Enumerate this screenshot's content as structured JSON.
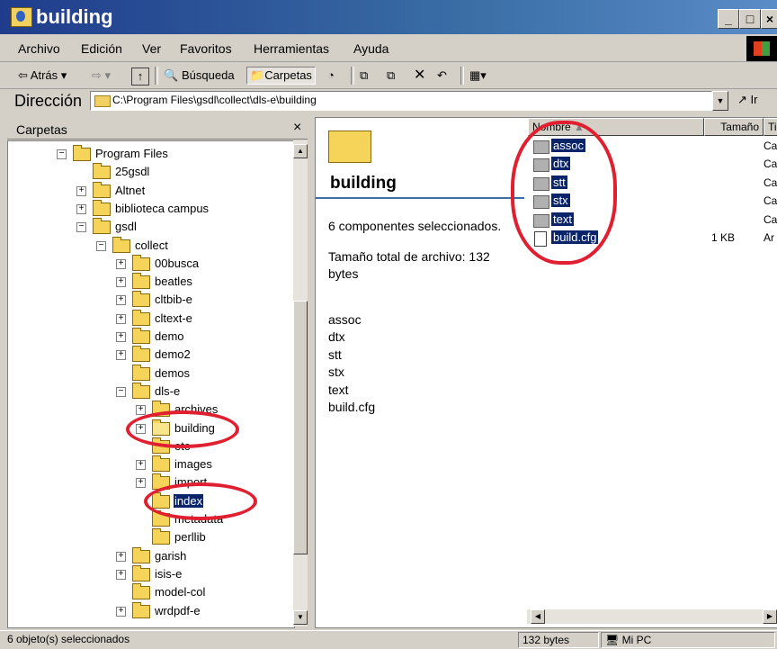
{
  "window": {
    "title": "building"
  },
  "menu": [
    "Archivo",
    "Edición",
    "Ver",
    "Favoritos",
    "Herramientas",
    "Ayuda"
  ],
  "toolbar": {
    "back": "⇦ Atrás ▾",
    "forward": "⇨ ▾",
    "search": "Búsqueda",
    "folders": "Carpetas"
  },
  "address": {
    "label": "Dirección",
    "value": "C:\\Program Files\\gsdl\\collect\\dls-e\\building",
    "go": "Ir"
  },
  "folders_pane": {
    "title": "Carpetas",
    "close": "×",
    "tree": [
      {
        "label": "Program Files",
        "level": 0,
        "expander": "-"
      },
      {
        "label": "25gsdl",
        "level": 1,
        "expander": ""
      },
      {
        "label": "Altnet",
        "level": 1,
        "expander": "+"
      },
      {
        "label": "biblioteca campus",
        "level": 1,
        "expander": "+"
      },
      {
        "label": "gsdl",
        "level": 1,
        "expander": "-"
      },
      {
        "label": "collect",
        "level": 2,
        "expander": "-"
      },
      {
        "label": "00busca",
        "level": 3,
        "expander": "+"
      },
      {
        "label": "beatles",
        "level": 3,
        "expander": "+"
      },
      {
        "label": "cltbib-e",
        "level": 3,
        "expander": "+"
      },
      {
        "label": "cltext-e",
        "level": 3,
        "expander": "+"
      },
      {
        "label": "demo",
        "level": 3,
        "expander": "+"
      },
      {
        "label": "demo2",
        "level": 3,
        "expander": "+"
      },
      {
        "label": "demos",
        "level": 3,
        "expander": ""
      },
      {
        "label": "dls-e",
        "level": 3,
        "expander": "-"
      },
      {
        "label": "archives",
        "level": 4,
        "expander": "+"
      },
      {
        "label": "building",
        "level": 4,
        "expander": "+",
        "open": true
      },
      {
        "label": "etc",
        "level": 4,
        "expander": ""
      },
      {
        "label": "images",
        "level": 4,
        "expander": "+"
      },
      {
        "label": "import",
        "level": 4,
        "expander": "+"
      },
      {
        "label": "index",
        "level": 4,
        "expander": "",
        "selected": true
      },
      {
        "label": "metadata",
        "level": 4,
        "expander": ""
      },
      {
        "label": "perllib",
        "level": 4,
        "expander": ""
      },
      {
        "label": "garish",
        "level": 3,
        "expander": "+"
      },
      {
        "label": "isis-e",
        "level": 3,
        "expander": "+"
      },
      {
        "label": "model-col",
        "level": 3,
        "expander": ""
      },
      {
        "label": "wrdpdf-e",
        "level": 3,
        "expander": "+"
      }
    ]
  },
  "info_panel": {
    "title": "building",
    "selected": "6 componentes seleccionados.",
    "size_line1": "Tamaño total de archivo: 132",
    "size_line2": "bytes",
    "items": [
      "assoc",
      "dtx",
      "stt",
      "stx",
      "text",
      "build.cfg"
    ]
  },
  "file_list": {
    "columns": [
      "Nombre",
      "Tamaño",
      "Ti"
    ],
    "rows": [
      {
        "name": "assoc",
        "size": "",
        "type": "Ca",
        "kind": "folder"
      },
      {
        "name": "dtx",
        "size": "",
        "type": "Ca",
        "kind": "folder"
      },
      {
        "name": "stt",
        "size": "",
        "type": "Ca",
        "kind": "folder"
      },
      {
        "name": "stx",
        "size": "",
        "type": "Ca",
        "kind": "folder"
      },
      {
        "name": "text",
        "size": "",
        "type": "Ca",
        "kind": "folder"
      },
      {
        "name": "build.cfg",
        "size": "1 KB",
        "type": "Ar",
        "kind": "file"
      }
    ]
  },
  "status": {
    "objects": "6 objeto(s) seleccionados",
    "size": "132 bytes",
    "location": "Mi PC"
  },
  "colors": {
    "selection": "#0a246a",
    "annotation": "#e02030",
    "titlebar": "#1f3c8c"
  }
}
